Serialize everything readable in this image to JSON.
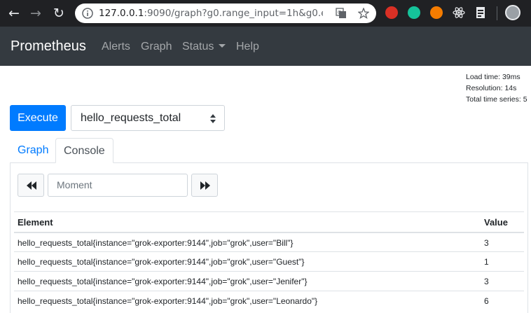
{
  "browser": {
    "url_host": "127.0.0.1",
    "url_rest": ":9090/graph?g0.range_input=1h&g0.expr..."
  },
  "navbar": {
    "brand": "Prometheus",
    "links": [
      "Alerts",
      "Graph",
      "Status",
      "Help"
    ]
  },
  "stats": {
    "load_time": "Load time: 39ms",
    "resolution": "Resolution: 14s",
    "total_series": "Total time series: 5"
  },
  "query": {
    "execute_label": "Execute",
    "selected_metric": "hello_requests_total"
  },
  "tabs": {
    "graph": "Graph",
    "console": "Console",
    "active": "Console"
  },
  "console": {
    "moment_placeholder": "Moment"
  },
  "table": {
    "headers": [
      "Element",
      "Value"
    ],
    "rows": [
      {
        "element": "hello_requests_total{instance=\"grok-exporter:9144\",job=\"grok\",user=\"Bill\"}",
        "value": "3"
      },
      {
        "element": "hello_requests_total{instance=\"grok-exporter:9144\",job=\"grok\",user=\"Guest\"}",
        "value": "1"
      },
      {
        "element": "hello_requests_total{instance=\"grok-exporter:9144\",job=\"grok\",user=\"Jenifer\"}",
        "value": "3"
      },
      {
        "element": "hello_requests_total{instance=\"grok-exporter:9144\",job=\"grok\",user=\"Leonardo\"}",
        "value": "6"
      }
    ]
  },
  "colors": {
    "navbar_bg": "#343a40",
    "primary": "#007bff",
    "browser_bg": "#202124"
  }
}
